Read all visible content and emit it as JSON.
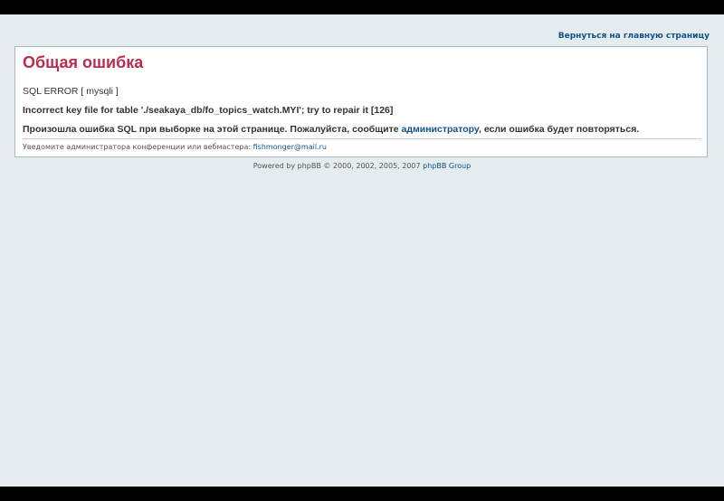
{
  "header": {
    "home_link": "Вернуться на главную страницу"
  },
  "error": {
    "title": "Общая ошибка",
    "sql_error": "SQL ERROR [ mysqli ]",
    "message": "Incorrect key file for table './seakaya_db/fo_topics_watch.MYI'; try to repair it [126]",
    "notice_before": "Произошла ошибка SQL при выборке на этой странице. Пожалуйста, сообщите ",
    "notice_link": "администратору",
    "notice_after": ", если ошибка будет повторяться.",
    "contact_text": "Уведомите администратора конференции или вебмастера: ",
    "contact_email": "fishmonger@mail.ru"
  },
  "footer": {
    "powered_text": "Powered by phpBB © 2000, 2002, 2005, 2007 ",
    "group_link": "phpBB Group"
  },
  "colors": {
    "background": "#e5ecf0",
    "title": "#bc2a4d",
    "link": "#105289"
  }
}
